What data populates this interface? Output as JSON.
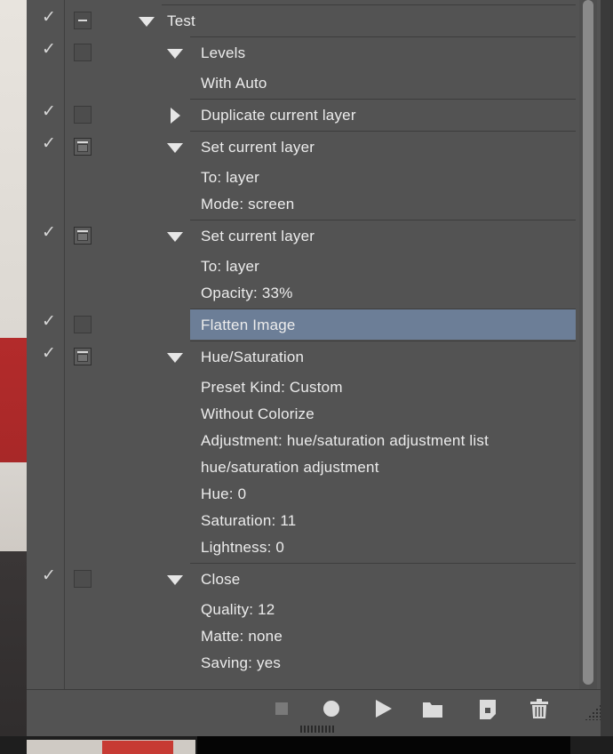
{
  "actions": [
    {
      "label": "Test",
      "checked": true,
      "dialog": "partial",
      "expand": "down",
      "level": 0
    },
    {
      "label": "Levels",
      "checked": true,
      "dialog": "off",
      "expand": "down",
      "level": 1,
      "params": [
        "With Auto"
      ]
    },
    {
      "label": "Duplicate current layer",
      "checked": true,
      "dialog": "off",
      "expand": "right",
      "level": 1
    },
    {
      "label": "Set current layer",
      "checked": true,
      "dialog": "on",
      "expand": "down",
      "level": 1,
      "params": [
        "To: layer",
        "Mode: screen"
      ]
    },
    {
      "label": "Set current layer",
      "checked": true,
      "dialog": "on",
      "expand": "down",
      "level": 1,
      "params": [
        "To: layer",
        "Opacity: 33%"
      ]
    },
    {
      "label": "Flatten Image",
      "checked": true,
      "dialog": "off",
      "expand": "none",
      "level": 1,
      "selected": true
    },
    {
      "label": "Hue/Saturation",
      "checked": true,
      "dialog": "on",
      "expand": "down",
      "level": 1,
      "params": [
        "Preset Kind: Custom",
        "Without Colorize",
        "Adjustment: hue/saturation adjustment list",
        "hue/saturation adjustment",
        "Hue: 0",
        "Saturation: 11",
        "Lightness: 0"
      ]
    },
    {
      "label": "Close",
      "checked": true,
      "dialog": "off",
      "expand": "down",
      "level": 1,
      "params": [
        "Quality: 12",
        "Matte: none",
        "Saving: yes"
      ]
    }
  ],
  "toolbar": [
    "stop-icon",
    "record-icon",
    "play-icon",
    "new-set-folder-icon",
    "new-action-icon",
    "delete-trash-icon"
  ],
  "colors": {
    "panel": "#535353",
    "selected": "#6c7e97",
    "text": "#ececec"
  }
}
